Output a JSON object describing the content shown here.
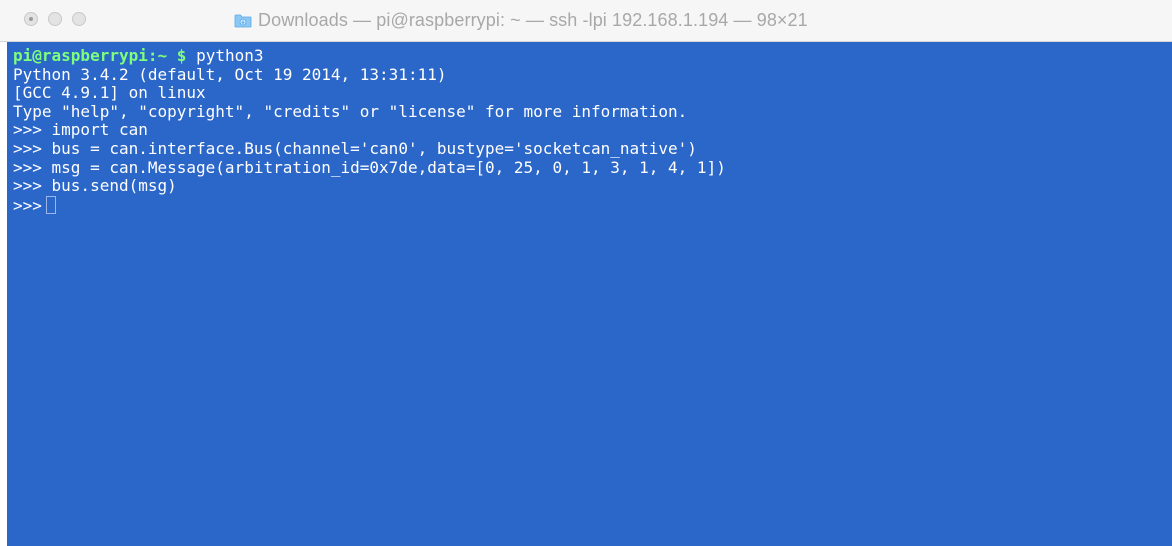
{
  "window": {
    "title": "Downloads — pi@raspberrypi: ~ — ssh -lpi 192.168.1.194 — 98×21",
    "title_icon": "folder-icon",
    "colors": {
      "terminal_background": "#2b66c9",
      "terminal_text": "#ffffff",
      "prompt_user": "#7dff7d"
    }
  },
  "terminal": {
    "prompt": {
      "user_host": "pi@raspberrypi:",
      "path": "~",
      "symbol": "$",
      "command": "python3"
    },
    "lines": [
      "Python 3.4.2 (default, Oct 19 2014, 13:31:11)",
      "[GCC 4.9.1] on linux",
      "Type \"help\", \"copyright\", \"credits\" or \"license\" for more information.",
      ">>> import can",
      ">>> bus = can.interface.Bus(channel='can0', bustype='socketcan_native')",
      ">>> msg = can.Message(arbitration_id=0x7de,data=[0, 25, 0, 1, 3, 1, 4, 1])",
      ">>> bus.send(msg)"
    ],
    "current_prompt": ">>>"
  }
}
